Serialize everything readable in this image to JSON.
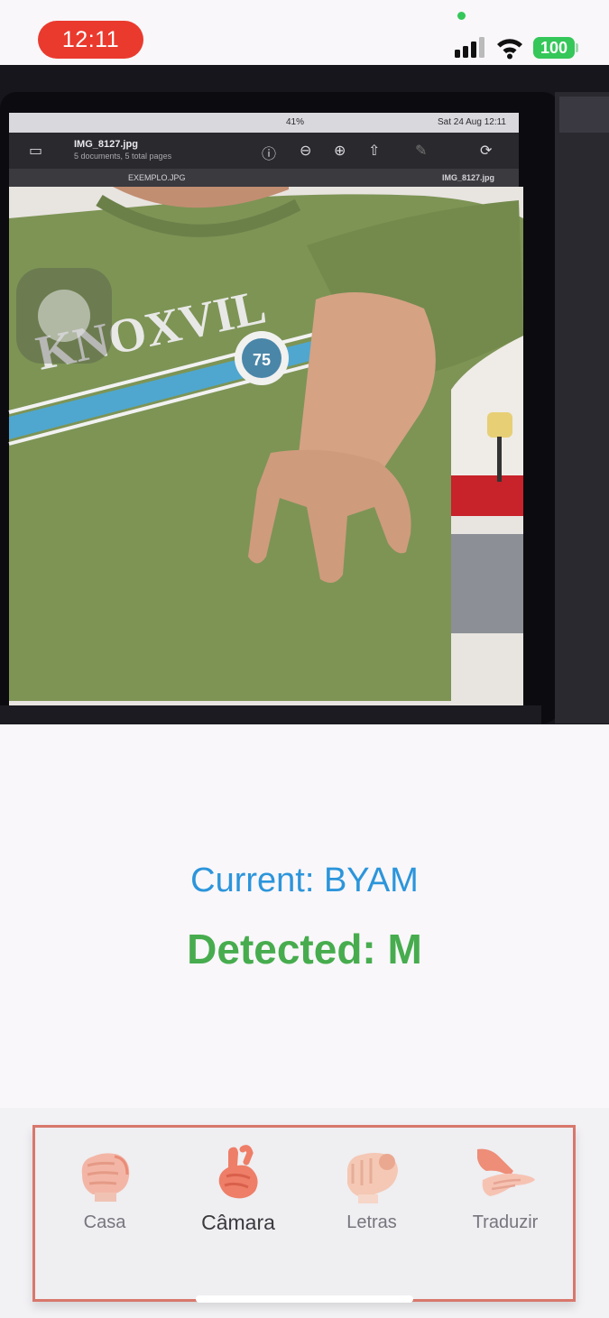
{
  "status_bar": {
    "time": "12:11",
    "battery": "100"
  },
  "camera_screen": {
    "menubar_battery": "41%",
    "menubar_datetime": "Sat 24 Aug  12:11",
    "file_title": "IMG_8127.jpg",
    "file_subtitle": "5 documents, 5 total pages",
    "tab_left": "EXEMPLO.JPG",
    "tab_right": "IMG_8127.jpg",
    "shirt_text": "KNOXVIL",
    "badge_number": "75"
  },
  "result": {
    "current": "Current: BYAM",
    "detected": "Detected: M"
  },
  "nav": {
    "items": [
      {
        "label": "Casa"
      },
      {
        "label": "Câmara"
      },
      {
        "label": "Letras"
      },
      {
        "label": "Traduzir"
      }
    ]
  },
  "colors": {
    "current_text": "#2c95db",
    "detected_text": "#47ac4e",
    "nav_border": "#d8776c",
    "time_pill": "#ea3a2e",
    "battery": "#35c759"
  }
}
